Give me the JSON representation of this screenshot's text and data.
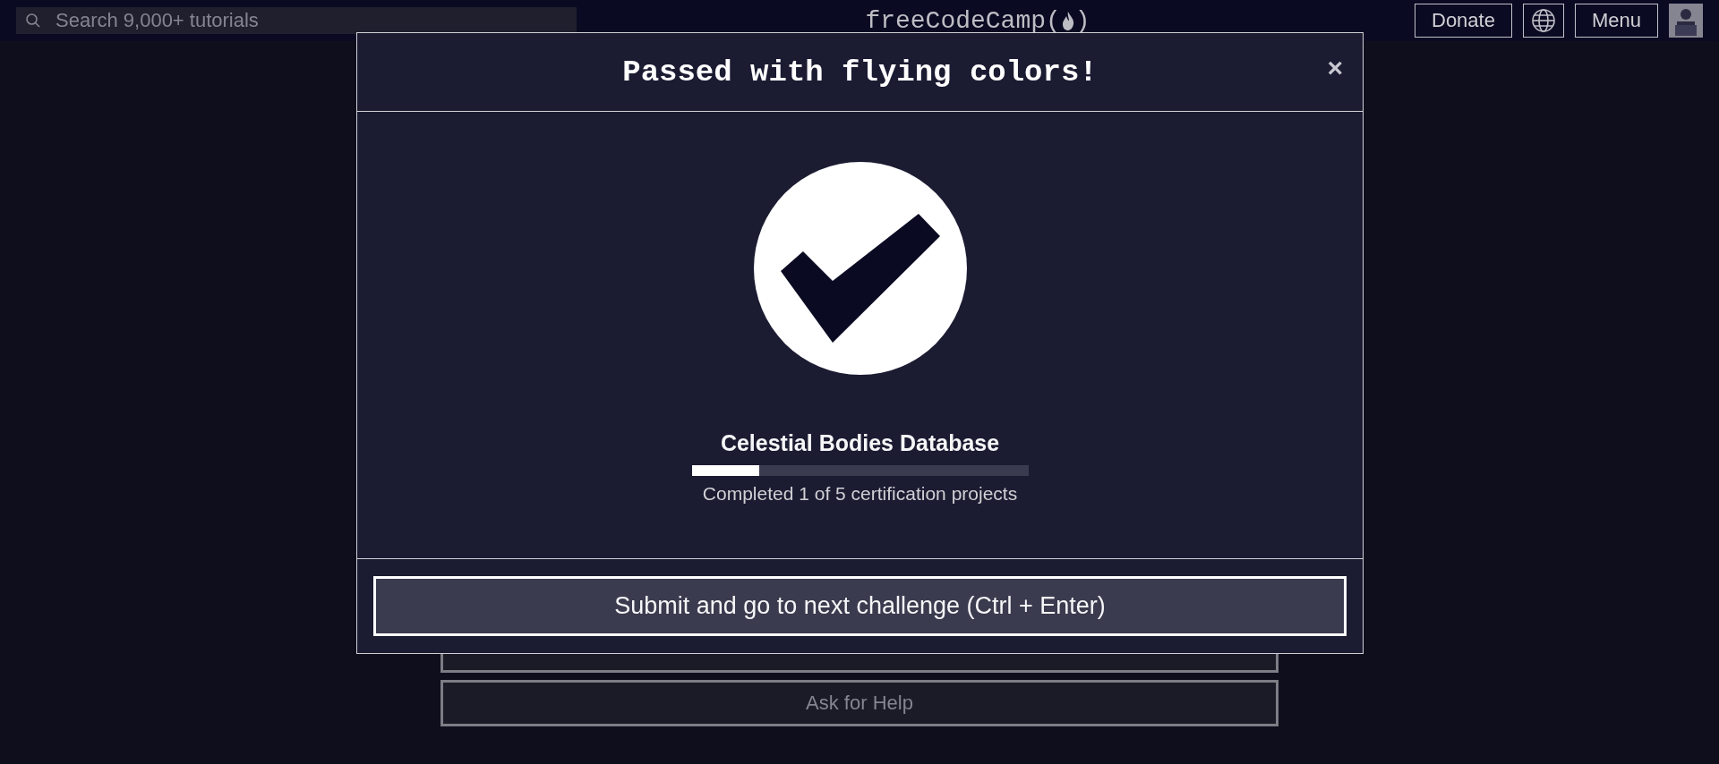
{
  "navbar": {
    "search": {
      "placeholder": "Search 9,000+ tutorials"
    },
    "logo": {
      "before": "freeCodeCamp(",
      "after": ")"
    },
    "buttons": [
      "Donate",
      "Menu"
    ]
  },
  "page": {
    "buttons": [
      "Ask for Help"
    ]
  },
  "modal": {
    "title": "Passed with flying colors!",
    "close": "×",
    "project": "Celestial Bodies Database",
    "progress": {
      "level": 0.2
    },
    "progress_text": "Completed 1 of 5 certification projects",
    "submit": "Submit and go to next challenge (Ctrl + Enter)"
  }
}
